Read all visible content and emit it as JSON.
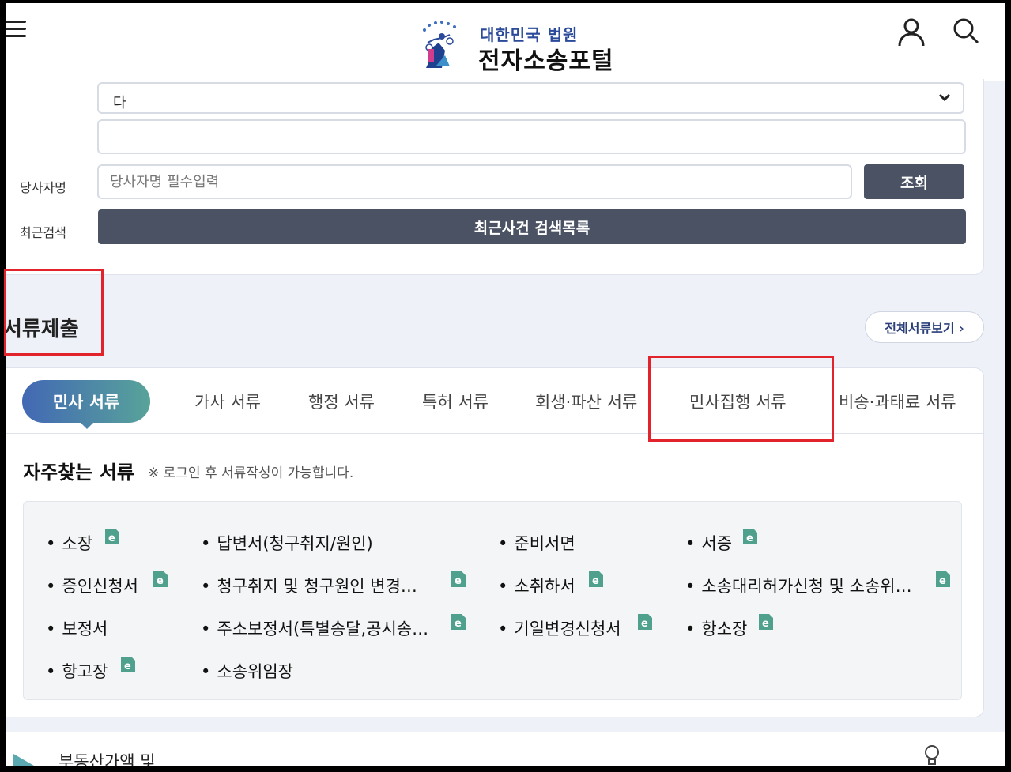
{
  "header": {
    "logo_small": "대한민국 법원",
    "logo_big": "전자소송포털",
    "menu_icon": "hamburger-menu-icon",
    "user_icon": "user-icon",
    "search_icon": "search-icon"
  },
  "search": {
    "select_value": "다",
    "party_label": "당사자명",
    "party_placeholder": "당사자명 필수입력",
    "query_button": "조회",
    "recent_label": "최근검색",
    "recent_button": "최근사건 검색목록"
  },
  "documents": {
    "section_title": "서류제출",
    "all_docs_button": "전체서류보기 ›",
    "tabs": [
      "민사 서류",
      "가사 서류",
      "행정 서류",
      "특허 서류",
      "회생·파산 서류",
      "민사집행 서류",
      "비송·과태료 서류"
    ],
    "active_tab": "민사 서류",
    "frequent_title": "자주찾는 서류",
    "frequent_note": "※ 로그인 후 서류작성이 가능합니다.",
    "items": [
      {
        "label": "소장",
        "e_form": true
      },
      {
        "label": "답변서(청구취지/원인)",
        "e_form": false
      },
      {
        "label": "준비서면",
        "e_form": false
      },
      {
        "label": "서증",
        "e_form": true
      },
      {
        "label": "증인신청서",
        "e_form": true
      },
      {
        "label": "청구취지 및 청구원인 변경…",
        "e_form": true
      },
      {
        "label": "소취하서",
        "e_form": true
      },
      {
        "label": "소송대리허가신청 및 소송위…",
        "e_form": true
      },
      {
        "label": "보정서",
        "e_form": false
      },
      {
        "label": "주소보정서(특별송달,공시송…",
        "e_form": true
      },
      {
        "label": "기일변경신청서",
        "e_form": true
      },
      {
        "label": "항소장",
        "e_form": true
      },
      {
        "label": "항고장",
        "e_form": true
      },
      {
        "label": "소송위임장",
        "e_form": false
      }
    ]
  },
  "bottom": {
    "partial_text": "부동산가액 및"
  },
  "colors": {
    "accent_dark": "#4a5263",
    "tab_gradient_start": "#4268b4",
    "tab_gradient_end": "#58a39a",
    "annotation_red": "#e3232b"
  }
}
